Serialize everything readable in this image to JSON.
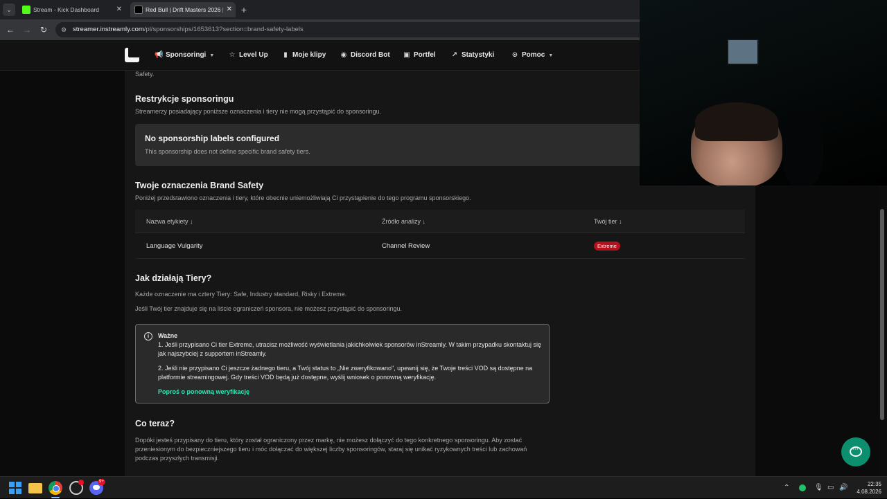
{
  "browser": {
    "tabs": [
      {
        "title": "Stream - Kick Dashboard",
        "favicon_color": "#53fc18",
        "close": "✕"
      },
      {
        "title": "Red Bull | Drift Masters 2026 | i",
        "favicon_color": "#000000",
        "close": "✕"
      }
    ],
    "new_tab": "+",
    "url_host": "streamer.instreamly.com",
    "url_path": "/pl/sponsorships/1653613?section=brand-safety-labels"
  },
  "nav": {
    "items": [
      {
        "label": "Sponsoringi",
        "icon": "megaphone-icon",
        "glyph": "📢"
      },
      {
        "label": "Level Up",
        "icon": "star-icon",
        "glyph": "☆"
      },
      {
        "label": "Moje klipy",
        "icon": "clip-icon",
        "glyph": "▮"
      },
      {
        "label": "Discord Bot",
        "icon": "discord-icon",
        "glyph": "◉"
      },
      {
        "label": "Portfel",
        "icon": "wallet-icon",
        "glyph": "▣"
      },
      {
        "label": "Statystyki",
        "icon": "chart-icon",
        "glyph": "↗"
      },
      {
        "label": "Pomoc",
        "icon": "help-icon",
        "glyph": "⊙"
      }
    ]
  },
  "page": {
    "cut_text": "Safety.",
    "restrictions_title": "Restrykcje sponsoringu",
    "restrictions_desc": "Streamerzy posiadający poniższe oznaczenia i tiery nie mogą przystąpić do sponsoringu.",
    "empty_title": "No sponsorship labels configured",
    "empty_desc": "This sponsorship does not define specific brand safety tiers.",
    "labels_title": "Twoje oznaczenia Brand Safety",
    "labels_desc": "Poniżej przedstawiono oznaczenia i tiery, które obecnie uniemożliwiają Ci przystąpienie do tego programu sponsorskiego.",
    "table": {
      "headers": [
        "Nazwa etykiety ↓",
        "Źródło analizy ↓",
        "Twój tier ↓"
      ],
      "rows": [
        {
          "label": "Language Vulgarity",
          "source": "Channel Review",
          "tier": "Extreme"
        }
      ]
    },
    "tiers_title": "Jak działają Tiery?",
    "tiers_p1": "Każde oznaczenie ma cztery Tiery: Safe, Industry standard, Risky i Extreme.",
    "tiers_p2": "Jeśli Twój tier znajduje się na liście ograniczeń sponsora, nie możesz przystąpić do sponsoringu.",
    "notice": {
      "title": "Ważne",
      "p1": "1. Jeśli przypisano Ci tier Extreme, utracisz możliwość wyświetlania jakichkolwiek sponsorów inStreamly. W takim przypadku skontaktuj się jak najszybciej z supportem inStreamly.",
      "p2": "2. Jeśli nie przypisano Ci jeszcze żadnego tieru, a Twój status to „Nie zweryfikowano\", upewnij się, że Twoje treści VOD są dostępne na platformie streamingowej. Gdy treści VOD będą już dostępne, wyślij wniosek o ponowną weryfikację.",
      "link": "Poproś o ponowną weryfikację"
    },
    "next_title": "Co teraz?",
    "next_desc": "Dopóki jesteś przypisany do tieru, który został ograniczony przez markę, nie możesz dołączyć do tego konkretnego sponsoringu. Aby zostać przeniesionym do bezpieczniejszego tieru i móc dołączać do większej liczby sponsoringów, staraj się unikać ryzykownych treści lub zachowań podczas przyszłych transmisji."
  },
  "taskbar": {
    "discord_badge": "9+",
    "time": "22:35",
    "date": "4.08.2026"
  },
  "colors": {
    "accent": "#38e4b4",
    "badge_extreme": "#b3121d",
    "fab": "#0c8f6e"
  }
}
